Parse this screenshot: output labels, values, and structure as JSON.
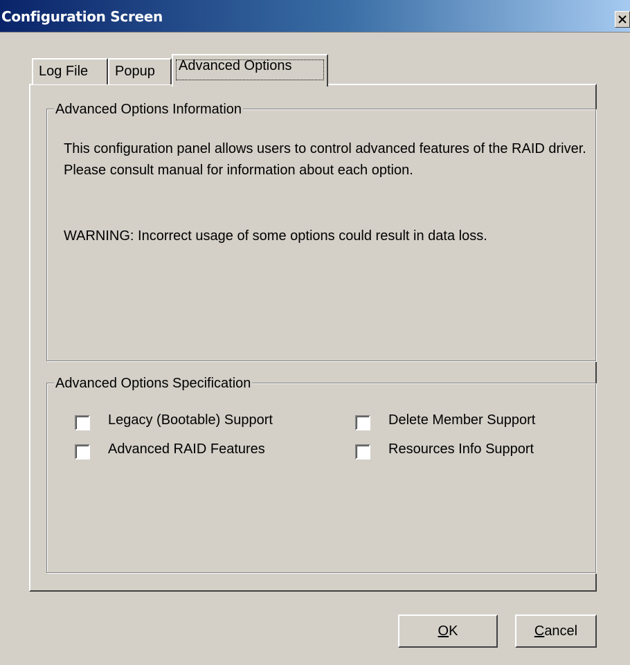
{
  "window": {
    "title": "Configuration Screen",
    "close_icon": "close-icon",
    "close_label": "X"
  },
  "tabs": [
    {
      "label": "Log File",
      "selected": false
    },
    {
      "label": "Popup",
      "selected": false
    },
    {
      "label": "Advanced Options",
      "selected": true
    }
  ],
  "info_group": {
    "legend": "Advanced Options Information",
    "text": "This configuration panel allows users to control advanced features of the RAID driver. Please consult manual for information about each option.",
    "warning": "WARNING: Incorrect usage of some options could result in data loss."
  },
  "spec_group": {
    "legend": "Advanced Options Specification",
    "options": [
      {
        "label": "Legacy (Bootable) Support",
        "checked": false
      },
      {
        "label": "Delete Member Support",
        "checked": false
      },
      {
        "label": "Advanced RAID Features",
        "checked": false
      },
      {
        "label": "Resources Info Support",
        "checked": false
      }
    ]
  },
  "buttons": {
    "ok_mnemonic": "O",
    "ok_rest": "K",
    "cancel_mnemonic": "C",
    "cancel_rest": "ancel"
  },
  "colors": {
    "face": "#d4d0c8",
    "title_start": "#0a246a",
    "title_end": "#a6caf0"
  }
}
